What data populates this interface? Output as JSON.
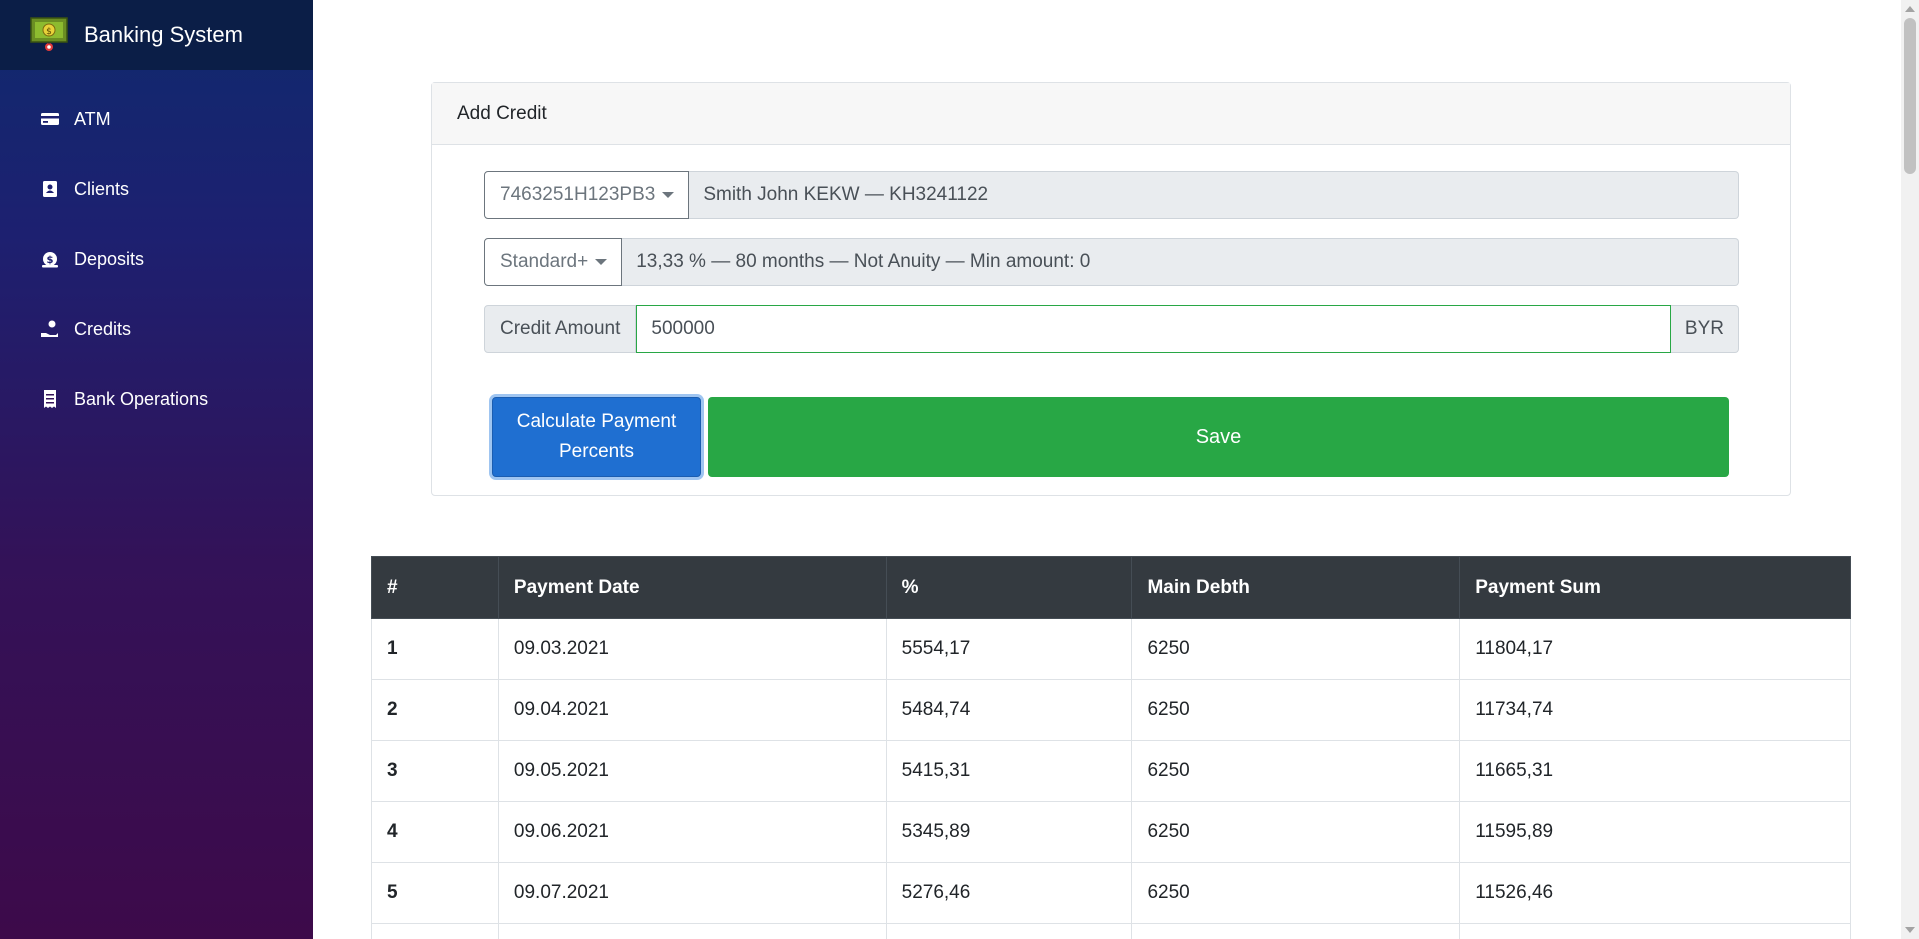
{
  "app": {
    "title": "Banking System"
  },
  "sidebar": {
    "items": [
      {
        "label": "ATM",
        "icon": "credit-card-icon"
      },
      {
        "label": "Clients",
        "icon": "contact-book-icon"
      },
      {
        "label": "Deposits",
        "icon": "money-bag-icon"
      },
      {
        "label": "Credits",
        "icon": "hand-holding-money-icon"
      },
      {
        "label": "Bank Operations",
        "icon": "receipt-icon"
      }
    ]
  },
  "form": {
    "header": "Add Credit",
    "account_select": "7463251H123PB3",
    "client_info": "Smith John KEKW — KH3241122",
    "plan_select": "Standard+",
    "plan_info": "13,33 % — 80 months — Not Anuity — Min amount: 0",
    "amount_label": "Credit Amount",
    "amount_value": "500000",
    "currency": "BYR",
    "calc_button": "Calculate Payment Percents",
    "save_button": "Save"
  },
  "table": {
    "headers": [
      "#",
      "Payment Date",
      "%",
      "Main Debth",
      "Payment Sum"
    ],
    "rows": [
      [
        "1",
        "09.03.2021",
        "5554,17",
        "6250",
        "11804,17"
      ],
      [
        "2",
        "09.04.2021",
        "5484,74",
        "6250",
        "11734,74"
      ],
      [
        "3",
        "09.05.2021",
        "5415,31",
        "6250",
        "11665,31"
      ],
      [
        "4",
        "09.06.2021",
        "5345,89",
        "6250",
        "11595,89"
      ],
      [
        "5",
        "09.07.2021",
        "5276,46",
        "6250",
        "11526,46"
      ]
    ]
  },
  "colors": {
    "sidebar_top": "#0f2a6e",
    "sidebar_bottom": "#3d0a4a",
    "primary": "#1f6fd1",
    "success": "#28a745",
    "table_header": "#343a40"
  }
}
